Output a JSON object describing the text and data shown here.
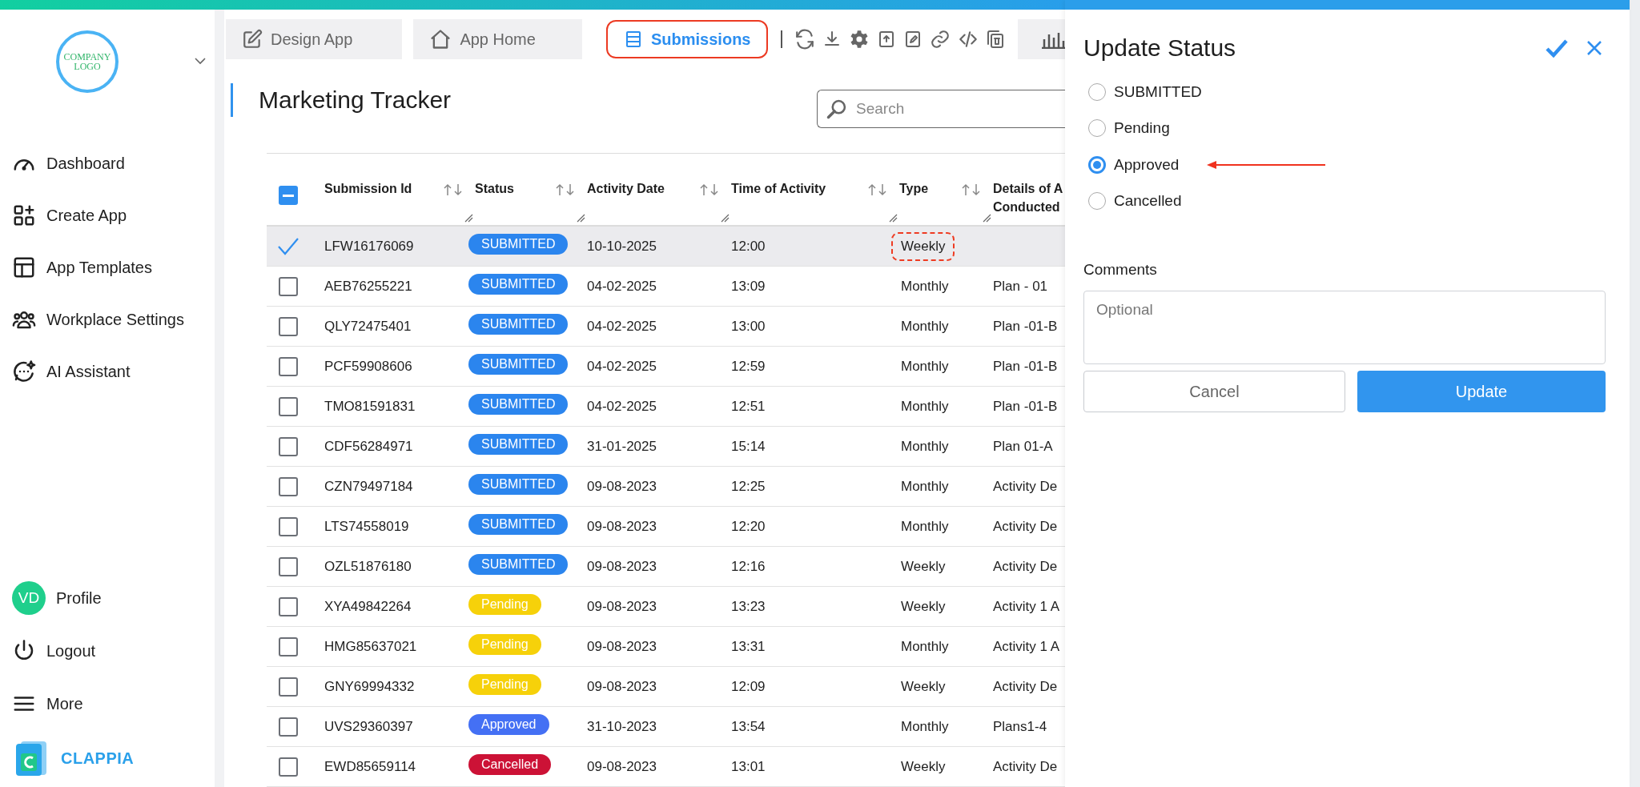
{
  "sidebar": {
    "logo": {
      "line_1": "COMPANY",
      "line_2": "LOGO"
    },
    "nav": [
      {
        "label": "Dashboard"
      },
      {
        "label": "Create App"
      },
      {
        "label": "App Templates"
      },
      {
        "label": "Workplace Settings"
      },
      {
        "label": "AI Assistant"
      }
    ],
    "profile": {
      "initials": "VD",
      "label": "Profile"
    },
    "bottom": [
      {
        "label": "Logout"
      },
      {
        "label": "More"
      }
    ],
    "brand": "CLAPPIA"
  },
  "tabs": [
    {
      "label": "Design App",
      "selected": false,
      "highlighted": false
    },
    {
      "label": "App Home",
      "selected": false,
      "highlighted": false
    },
    {
      "label": "Submissions",
      "selected": true,
      "highlighted": true
    }
  ],
  "page": {
    "title": "Marketing Tracker",
    "search": {
      "placeholder": "Search"
    }
  },
  "table": {
    "select_all_indeterminate": true,
    "columns": [
      "Submission Id",
      "Status",
      "Activity Date",
      "Time of Activity",
      "Type",
      "Details of A\nConducted"
    ],
    "rows": [
      {
        "id": "LFW16176069",
        "status": {
          "label": "SUBMITTED",
          "color": "#2b85ee"
        },
        "date": "10-10-2025",
        "time": "12:00",
        "type": "Weekly",
        "selected": true,
        "type_highlighted": true
      },
      {
        "id": "AEB76255221",
        "status": {
          "label": "SUBMITTED",
          "color": "#2b85ee"
        },
        "date": "04-02-2025",
        "time": "13:09",
        "type": "Monthly",
        "details": "Plan - 01",
        "selected": false,
        "type_highlighted": false
      },
      {
        "id": "QLY72475401",
        "status": {
          "label": "SUBMITTED",
          "color": "#2b85ee"
        },
        "date": "04-02-2025",
        "time": "13:00",
        "type": "Monthly",
        "details": "Plan -01-B",
        "selected": false,
        "type_highlighted": false
      },
      {
        "id": "PCF59908606",
        "status": {
          "label": "SUBMITTED",
          "color": "#2b85ee"
        },
        "date": "04-02-2025",
        "time": "12:59",
        "type": "Monthly",
        "details": "Plan -01-B",
        "selected": false,
        "type_highlighted": false
      },
      {
        "id": "TMO81591831",
        "status": {
          "label": "SUBMITTED",
          "color": "#2b85ee"
        },
        "date": "04-02-2025",
        "time": "12:51",
        "type": "Monthly",
        "details": "Plan -01-B",
        "selected": false,
        "type_highlighted": false
      },
      {
        "id": "CDF56284971",
        "status": {
          "label": "SUBMITTED",
          "color": "#2b85ee"
        },
        "date": "31-01-2025",
        "time": "15:14",
        "type": "Monthly",
        "details": "Plan 01-A",
        "selected": false,
        "type_highlighted": false
      },
      {
        "id": "CZN79497184",
        "status": {
          "label": "SUBMITTED",
          "color": "#2b85ee"
        },
        "date": "09-08-2023",
        "time": "12:25",
        "type": "Monthly",
        "details": "Activity De",
        "selected": false,
        "type_highlighted": false
      },
      {
        "id": "LTS74558019",
        "status": {
          "label": "SUBMITTED",
          "color": "#2b85ee"
        },
        "date": "09-08-2023",
        "time": "12:20",
        "type": "Monthly",
        "details": "Activity De",
        "selected": false,
        "type_highlighted": false
      },
      {
        "id": "OZL51876180",
        "status": {
          "label": "SUBMITTED",
          "color": "#2b85ee"
        },
        "date": "09-08-2023",
        "time": "12:16",
        "type": "Weekly",
        "details": "Activity De",
        "selected": false,
        "type_highlighted": false
      },
      {
        "id": "XYA49842264",
        "status": {
          "label": "Pending",
          "color": "#f6d10a"
        },
        "date": "09-08-2023",
        "time": "13:23",
        "type": "Weekly",
        "details": "Activity 1 A",
        "selected": false,
        "type_highlighted": false
      },
      {
        "id": "HMG85637021",
        "status": {
          "label": "Pending",
          "color": "#f6d10a"
        },
        "date": "09-08-2023",
        "time": "13:31",
        "type": "Monthly",
        "details": "Activity 1 A",
        "selected": false,
        "type_highlighted": false
      },
      {
        "id": "GNY69994332",
        "status": {
          "label": "Pending",
          "color": "#f6d10a"
        },
        "date": "09-08-2023",
        "time": "12:09",
        "type": "Weekly",
        "details": "Activity De",
        "selected": false,
        "type_highlighted": false
      },
      {
        "id": "UVS29360397",
        "status": {
          "label": "Approved",
          "color": "#4470f4"
        },
        "date": "31-10-2023",
        "time": "13:54",
        "type": "Monthly",
        "details": "Plans1-4",
        "selected": false,
        "type_highlighted": false
      },
      {
        "id": "EWD85659114",
        "status": {
          "label": "Cancelled",
          "color": "#cc1236"
        },
        "date": "09-08-2023",
        "time": "13:01",
        "type": "Weekly",
        "details": "Activity De",
        "selected": false,
        "type_highlighted": false
      }
    ]
  },
  "panel": {
    "title": "Update Status",
    "options": [
      {
        "label": "SUBMITTED",
        "selected": false,
        "pointed": false
      },
      {
        "label": "Pending",
        "selected": false,
        "pointed": false
      },
      {
        "label": "Approved",
        "selected": true,
        "pointed": true
      },
      {
        "label": "Cancelled",
        "selected": false,
        "pointed": false
      }
    ],
    "comments": {
      "label": "Comments",
      "placeholder": "Optional"
    },
    "buttons": {
      "cancel": "Cancel",
      "update": "Update"
    }
  }
}
